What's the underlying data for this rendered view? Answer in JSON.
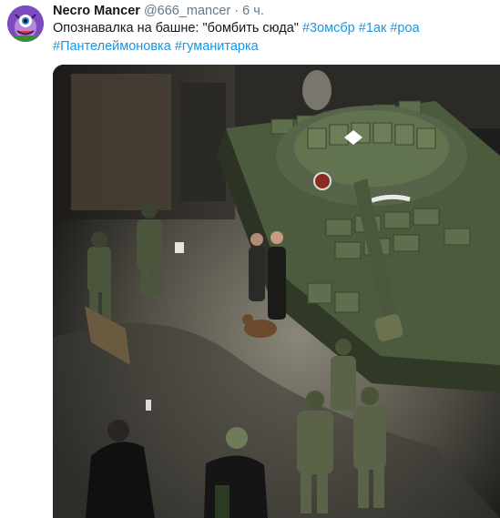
{
  "tweet": {
    "author_name": "Necro Mancer",
    "author_handle": "@666_mancer",
    "separator": "·",
    "timestamp": "6 ч.",
    "text_plain": "Опознавалка на башне: \"бомбить сюда\"",
    "hashtags": [
      "#3омсбр",
      "#1ак",
      "#роа",
      "#Пантелеймоновка",
      "#гуманитарка"
    ]
  },
  "colors": {
    "link": "#1b95e0",
    "secondary_text": "#657786",
    "primary_text": "#14171a"
  },
  "icons": {
    "avatar": "monster-avatar-icon"
  }
}
